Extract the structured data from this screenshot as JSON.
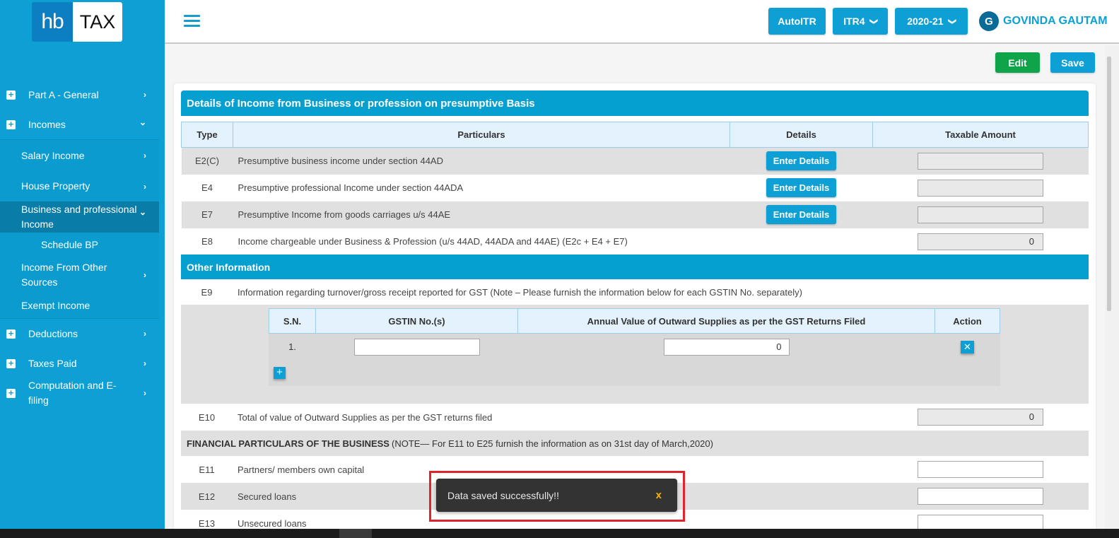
{
  "logo": {
    "part1": "hb",
    "part2": "TAX"
  },
  "sidebar": {
    "items": [
      {
        "label": "Part A - General",
        "chevron": "›"
      },
      {
        "label": "Incomes",
        "chevron": "⌄"
      },
      {
        "label": "Salary Income",
        "chevron": "›"
      },
      {
        "label": "House Property",
        "chevron": "›"
      },
      {
        "label": "Business and professional Income",
        "chevron": "⌄"
      },
      {
        "label": "Schedule BP"
      },
      {
        "label": "Income From Other Sources",
        "chevron": "›"
      },
      {
        "label": "Exempt Income"
      },
      {
        "label": "Deductions",
        "chevron": "›"
      },
      {
        "label": "Taxes Paid",
        "chevron": "›"
      },
      {
        "label": "Computation and E-filing",
        "chevron": "›"
      }
    ]
  },
  "header": {
    "autoitr": "AutoITR",
    "itr_form": "ITR4",
    "assessment_year": "2020-21",
    "user_initial": "G",
    "user_name": "GOVINDA GAUTAM"
  },
  "actions": {
    "edit": "Edit",
    "save": "Save"
  },
  "section1": {
    "title": "Details of Income from Business or profession on presumptive Basis",
    "columns": [
      "Type",
      "Particulars",
      "Details",
      "Taxable Amount"
    ],
    "rows": [
      {
        "type": "E2(C)",
        "particular": "Presumptive business income under section 44AD",
        "button": "Enter Details",
        "amount": ""
      },
      {
        "type": "E4",
        "particular": "Presumptive professional Income under section 44ADA",
        "button": "Enter Details",
        "amount": ""
      },
      {
        "type": "E7",
        "particular": "Presumptive Income from goods carriages u/s 44AE",
        "button": "Enter Details",
        "amount": ""
      },
      {
        "type": "E8",
        "particular": "Income chargeable under Business & Profession (u/s 44AD, 44ADA and 44AE) (E2c + E4 + E7)",
        "amount": "0"
      }
    ]
  },
  "section2": {
    "title": "Other Information",
    "e9": {
      "type": "E9",
      "particular": "Information regarding turnover/gross receipt reported for GST (Note – Please furnish the information below for each GSTIN No. separately)"
    },
    "gst_table": {
      "columns": [
        "S.N.",
        "GSTIN No.(s)",
        "Annual Value of Outward Supplies as per the GST Returns Filed",
        "Action"
      ],
      "rows": [
        {
          "sn": "1.",
          "gstin": "",
          "value": "0",
          "action": "✕"
        }
      ],
      "add_label": "+"
    },
    "e10": {
      "type": "E10",
      "particular": "Total of value of Outward Supplies as per the GST returns filed",
      "amount": "0"
    }
  },
  "financial": {
    "title_bold": "FINANCIAL PARTICULARS OF THE BUSINESS",
    "title_note": "(NOTE— For E11 to E25 furnish the information as on 31st day of March,2020)",
    "rows": [
      {
        "type": "E11",
        "particular": "Partners/ members own capital",
        "amount": ""
      },
      {
        "type": "E12",
        "particular": "Secured loans",
        "amount": ""
      },
      {
        "type": "E13",
        "particular": "Unsecured loans",
        "amount": ""
      }
    ]
  },
  "toast": {
    "message": "Data saved successfully!!",
    "close": "x"
  },
  "colors": {
    "primary": "#0ea0d4",
    "edit_green": "#0fa34a",
    "toast_bg": "#333333",
    "highlight_red": "#e0242b"
  }
}
